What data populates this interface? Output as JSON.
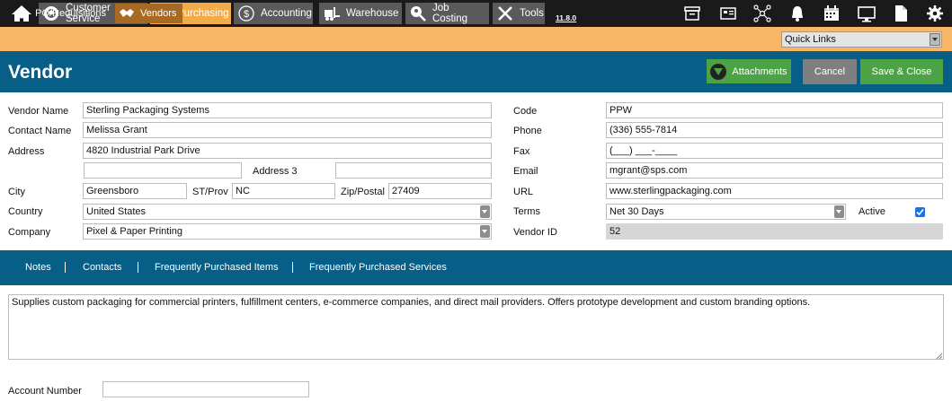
{
  "topnav": {
    "tabs": [
      {
        "label": "Customer Service",
        "icon": "customer-service-icon"
      },
      {
        "label": "Purchasing",
        "icon": "basket-icon"
      },
      {
        "label": "Accounting",
        "icon": "dollar-icon"
      },
      {
        "label": "Warehouse",
        "icon": "forklift-icon"
      },
      {
        "label": "Job Costing",
        "icon": "search-user-icon"
      },
      {
        "label": "Tools",
        "icon": "tools-icon"
      }
    ],
    "version": "11.8.0",
    "active_color": "#f3ab4a"
  },
  "subnav": {
    "tabs": [
      {
        "label": "PO/Requisitions",
        "icon": "basket-icon"
      },
      {
        "label": "Vendors",
        "icon": "handshake-icon"
      }
    ],
    "quick_links": "Quick Links"
  },
  "header": {
    "title": "Vendor",
    "attachments": "Attachments",
    "cancel": "Cancel",
    "save_close": "Save & Close"
  },
  "form": {
    "labels": {
      "vendor_name": "Vendor Name",
      "contact_name": "Contact Name",
      "address": "Address",
      "address3": "Address 3",
      "city": "City",
      "st_prov": "ST/Prov",
      "zip": "Zip/Postal",
      "country": "Country",
      "company": "Company",
      "code": "Code",
      "phone": "Phone",
      "fax": "Fax",
      "email": "Email",
      "url": "URL",
      "terms": "Terms",
      "active": "Active",
      "vendor_id": "Vendor ID",
      "account_number": "Account Number"
    },
    "values": {
      "vendor_name": "Sterling Packaging Systems",
      "contact_name": "Melissa Grant",
      "address1": "4820 Industrial Park Drive",
      "address2": "",
      "address3": "",
      "city": "Greensboro",
      "st_prov": "NC",
      "zip": "27409",
      "country": "United States",
      "company": "Pixel & Paper Printing",
      "code": "PPW",
      "phone": "(336) 555-7814",
      "fax": "(___) ___-____",
      "email": "mgrant@sps.com",
      "url": "www.sterlingpackaging.com",
      "terms": "Net 30 Days",
      "active": true,
      "vendor_id": "52",
      "account_number": ""
    }
  },
  "tabs": [
    "Notes",
    "Contacts",
    "Frequently Purchased Items",
    "Frequently Purchased Services"
  ],
  "notes_text": "Supplies custom packaging for commercial printers, fulfillment centers, e-commerce companies, and direct mail providers. Offers prototype development and custom branding options."
}
